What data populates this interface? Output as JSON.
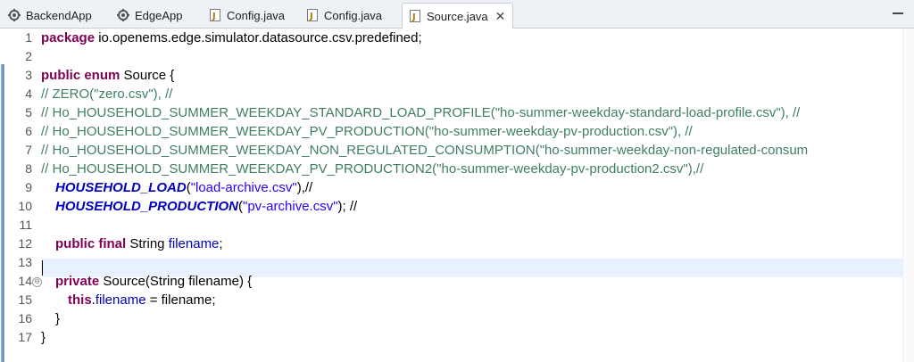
{
  "tabs": [
    {
      "label": "BackendApp",
      "icon": "app-icon"
    },
    {
      "label": "EdgeApp",
      "icon": "app-icon"
    },
    {
      "label": "Config.java",
      "icon": "java-file-icon"
    },
    {
      "label": "Config.java",
      "icon": "java-file-icon"
    },
    {
      "label": "Source.java",
      "icon": "java-file-icon",
      "active": true
    }
  ],
  "close_glyph": "✕",
  "line_numbers": [
    "1",
    "2",
    "3",
    "4",
    "5",
    "6",
    "7",
    "8",
    "9",
    "10",
    "11",
    "12",
    "13",
    "14",
    "15",
    "16",
    "17"
  ],
  "fold_glyph": "⊖",
  "code": {
    "l1": {
      "kw": "package",
      "rest": " io.openems.edge.simulator.datasource.csv.predefined;"
    },
    "l3": {
      "kw": "public enum",
      "rest": " Source {"
    },
    "l4": "// ZERO(\"zero.csv\"), //",
    "l5": "// Ho_HOUSEHOLD_SUMMER_WEEKDAY_STANDARD_LOAD_PROFILE(\"ho-summer-weekday-standard-load-profile.csv\"), //",
    "l6": "// Ho_HOUSEHOLD_SUMMER_WEEKDAY_PV_PRODUCTION(\"ho-summer-weekday-pv-production.csv\"), //",
    "l7": "// Ho_HOUSEHOLD_SUMMER_WEEKDAY_NON_REGULATED_CONSUMPTION(\"ho-summer-weekday-non-regulated-consum",
    "l8": "// Ho_HOUSEHOLD_SUMMER_WEEKDAY_PV_PRODUCTION2(\"ho-summer-weekday-pv-production2.csv\"),//",
    "l9": {
      "name": "HOUSEHOLD_LOAD",
      "open": "(",
      "str": "\"load-archive.csv\"",
      "close": "),//"
    },
    "l10": {
      "name": "HOUSEHOLD_PRODUCTION",
      "open": "(",
      "str": "\"pv-archive.csv\"",
      "close": "); //"
    },
    "l12": {
      "kw": "public final",
      "type": " String ",
      "field": "filename",
      "end": ";"
    },
    "l14": {
      "kw": "private",
      "rest": " Source(String ",
      "field": "filename",
      "end": ") {"
    },
    "l15": {
      "kw": "this",
      "dot": ".",
      "field": "filename",
      "mid": " = filename;"
    },
    "l16": "}",
    "l17": "}"
  }
}
